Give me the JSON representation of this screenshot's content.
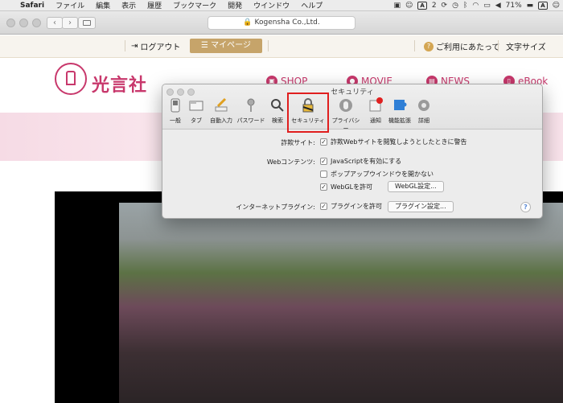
{
  "menubar": {
    "app": "Safari",
    "items": [
      "ファイル",
      "編集",
      "表示",
      "履歴",
      "ブックマーク",
      "開発",
      "ウインドウ",
      "ヘルプ"
    ],
    "status": {
      "notif_count": "2",
      "battery": "71%",
      "input_method": "A"
    }
  },
  "browser": {
    "url": "Kogensha Co.,Ltd."
  },
  "site": {
    "logout": "ログアウト",
    "mypage": "マイページ",
    "help": "ご利用にあたって",
    "fontsize": "文字サイズ",
    "logo_text": "光言社",
    "nav": [
      "SHOP",
      "MOVIE",
      "NEWS",
      "eBook"
    ]
  },
  "prefs": {
    "title": "セキュリティ",
    "toolbar": [
      "一般",
      "タブ",
      "自動入力",
      "パスワード",
      "検索",
      "セキュリティ",
      "プライバシー",
      "通知",
      "機能拡張",
      "詳細"
    ],
    "fraud_label": "詐欺サイト:",
    "fraud_option": "詐欺Webサイトを閲覧しようとしたときに警告",
    "web_label": "Webコンテンツ:",
    "js_option": "JavaScriptを有効にする",
    "popup_option": "ポップアップウインドウを開かない",
    "webgl_option": "WebGLを許可",
    "webgl_button": "WebGL設定...",
    "plugin_label": "インターネットプラグイン:",
    "plugin_option": "プラグインを許可",
    "plugin_button": "プラグイン設定...",
    "help_glyph": "?"
  }
}
